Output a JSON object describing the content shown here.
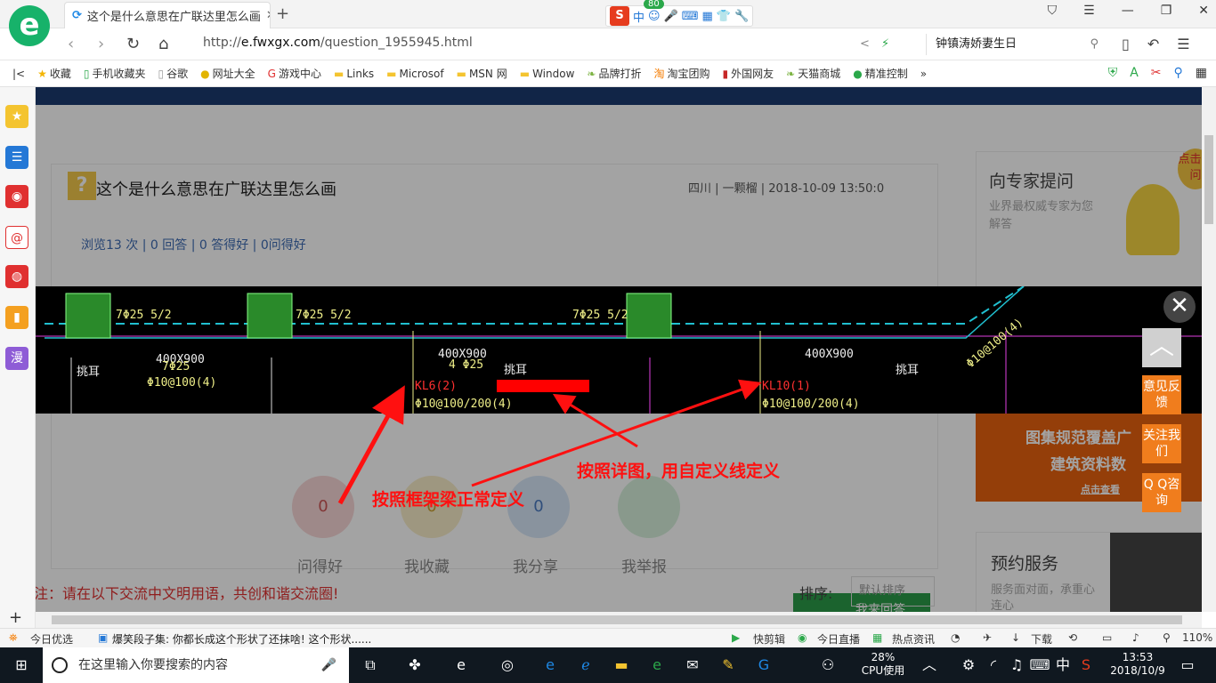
{
  "browser": {
    "logo_letter": "e",
    "tab_title": "这个是什么意思在广联达里怎么画",
    "tab_close": "✕",
    "new_tab": "+",
    "ime_badge": "80",
    "ime_text": "中",
    "url_prefix": "http://",
    "url_domain": "e.fwxgx.com",
    "url_path": "/question_1955945.html",
    "search_text": "钟镇涛娇妻生日",
    "bookmarks": [
      "收藏",
      "手机收藏夹",
      "谷歌",
      "网址大全",
      "游戏中心",
      "Links",
      "Microsof",
      "MSN 网",
      "Window",
      "品牌打折",
      "淘宝团购",
      "外国网友",
      "天猫商城",
      "精准控制"
    ],
    "bookmark_more": "»"
  },
  "page": {
    "question_title": "这个是什么意思在广联达里怎么画",
    "question_meta": "四川 | 一颗榴 | 2018-10-09 13:50:0",
    "stats": "浏览13 次 | 0 回答 | 0 答得好 | 0问得好",
    "actions": [
      {
        "label": "问得好",
        "count": "0",
        "color": "#f7d6d6"
      },
      {
        "label": "我收藏",
        "count": "0",
        "color": "#f7ecc8"
      },
      {
        "label": "我分享",
        "count": "0",
        "color": "#d6e6f7"
      },
      {
        "label": "我举报",
        "count": "",
        "color": "#d6f0dc"
      }
    ],
    "answer_button": "我来回答",
    "civil_notice": "注：请在以下交流中文明用语，共创和谐交流圈!",
    "sort_label": "排序:",
    "sort_value": "默认排序",
    "expert_title": "向专家提问",
    "expert_sub": "业界最权威专家为您解答",
    "expert_bubble": "点击提问",
    "ad_line1": "图集规范覆盖广",
    "ad_line2": "建筑资料数",
    "ad_line3": "点击查看",
    "booking_title": "预约服务",
    "booking_sub": "服务面对面，承重心连心"
  },
  "float_buttons": [
    "意见反馈",
    "关注我们",
    "Q Q咨询"
  ],
  "lightbox": {
    "close": "✕",
    "cad_texts": {
      "rebar1": "7Φ25 5/2",
      "rebar2": "7Φ25 5/2",
      "rebar3": "7Φ25 5/2",
      "section1": "400X900",
      "section1b": "7Φ25",
      "stirrup1": "Φ10@100(4)",
      "ear1": "挑耳",
      "section2": "400X900",
      "section2b": "4 Φ25",
      "beam2": "KL6(2)",
      "stirrup2": "Φ10@100/200(4)",
      "ear2": "挑耳",
      "section3": "400X900",
      "beam3": "KL10(1)",
      "stirrup3": "Φ10@100/200(4)",
      "ear3": "挑耳",
      "stirrup4": "Φ10@100(4)"
    },
    "annotation_left": "按照框架梁正常定义",
    "annotation_right": "按照详图，用自定义线定义"
  },
  "statusbar": {
    "left_label": "今日优选",
    "news": "爆笑段子集: 你都长成这个形状了还抹啥! 这个形状......",
    "items": [
      "快剪辑",
      "今日直播",
      "热点资讯",
      "下载"
    ],
    "zoom": "110%"
  },
  "taskbar": {
    "search_placeholder": "在这里输入你要搜索的内容",
    "cpu_percent": "28%",
    "cpu_label": "CPU使用",
    "ime": "中",
    "time": "13:53",
    "date": "2018/10/9"
  }
}
